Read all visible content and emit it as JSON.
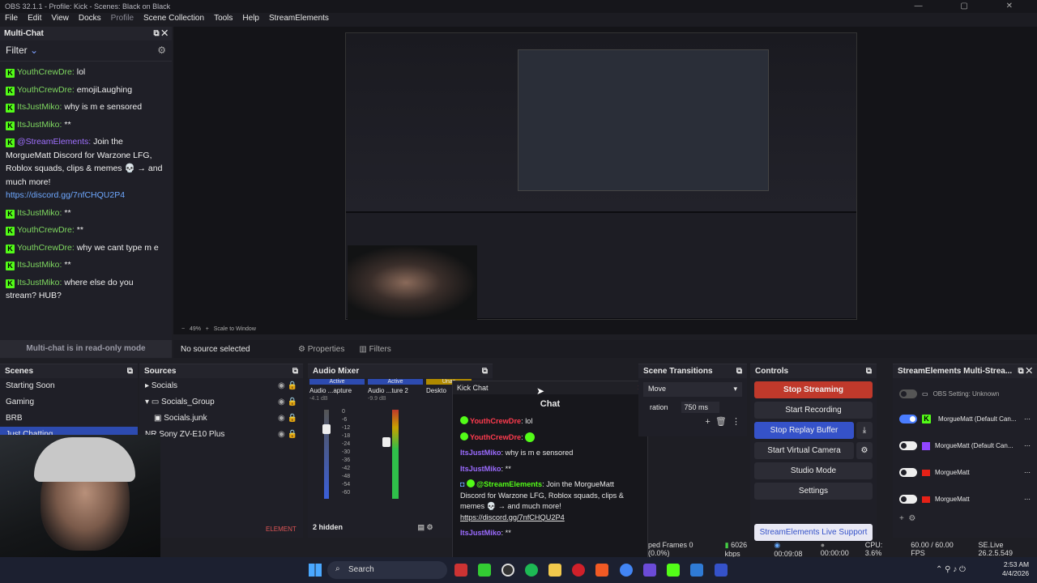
{
  "window": {
    "title": "OBS 32.1.1 - Profile: Kick - Scenes: Black on Black"
  },
  "menu": [
    "File",
    "Edit",
    "View",
    "Docks",
    "Profile",
    "Scene Collection",
    "Tools",
    "Help",
    "StreamElements"
  ],
  "multichat": {
    "title": "Multi-Chat",
    "filter_label": "Filter",
    "footer": "Multi-chat is in read-only mode",
    "messages": [
      {
        "user": "YouthCrewDre:",
        "text": " lol",
        "color": "green"
      },
      {
        "user": "YouthCrewDre:",
        "text": " emojiLaughing",
        "color": "green"
      },
      {
        "user": "ItsJustMiko:",
        "text": " why is m e sensored",
        "color": "green"
      },
      {
        "user": "ItsJustMiko:",
        "text": " **",
        "color": "green"
      },
      {
        "user": "@StreamElements:",
        "text": " Join the MorgueMatt Discord for Warzone LFG, Roblox squads, clips & memes 💀 → and much more!",
        "link": "https://discord.gg/7nfCHQU2P4",
        "color": "purple"
      },
      {
        "user": "ItsJustMiko:",
        "text": " **",
        "color": "green"
      },
      {
        "user": "YouthCrewDre:",
        "text": " **",
        "color": "green"
      },
      {
        "user": "YouthCrewDre:",
        "text": " why we cant type m e",
        "color": "green"
      },
      {
        "user": "ItsJustMiko:",
        "text": " **",
        "color": "green"
      },
      {
        "user": "ItsJustMiko:",
        "text": " where else do you stream? HUB?",
        "color": "green"
      }
    ]
  },
  "preview": {
    "zoom": "49%",
    "zoom_mode": "Scale to Window"
  },
  "propbar": {
    "no_source": "No source selected",
    "properties": "Properties",
    "filters": "Filters"
  },
  "scenes": {
    "title": "Scenes",
    "items": [
      "Starting Soon",
      "Gaming",
      "BRB",
      "Just Chatting"
    ]
  },
  "sources": {
    "title": "Sources",
    "items": [
      "Socials",
      "Socials_Group",
      "Socials.junk",
      "NR Sony ZV-E10 Plus"
    ]
  },
  "mixer": {
    "title": "Audio Mixer",
    "channels": [
      {
        "state": "Active",
        "name": "Audio ...apture",
        "db": "-4.1 dB"
      },
      {
        "state": "Active",
        "name": "Audio ...ture 2",
        "db": "-9.9 dB"
      },
      {
        "state": "Unac",
        "name": "Deskto",
        "db": "-4.1 dB"
      }
    ],
    "scale": [
      "0",
      "-6",
      "-12",
      "-18",
      "-24",
      "-30",
      "-36",
      "-42",
      "-48",
      "-54",
      "-60"
    ],
    "hidden": "2 hidden",
    "element_tag": "ELEMENT"
  },
  "kickchat": {
    "window_title": "Kick Chat",
    "title": "Chat",
    "lines": [
      {
        "user": "YouthCrewDre",
        "text": ": lol",
        "kind": "red"
      },
      {
        "user": "YouthCrewDre",
        "text": ":",
        "kind": "red"
      },
      {
        "user": "ItsJustMiko",
        "text": ": why is m e sensored",
        "kind": "purple"
      },
      {
        "user": "ItsJustMiko",
        "text": ": **",
        "kind": "purple"
      },
      {
        "user": "@StreamElements",
        "text": ": Join the MorgueMatt Discord for Warzone LFG, Roblox squads, clips & memes 💀 → and much more!",
        "link": "https://discord.gg/7nfCHQU2P4",
        "kind": "green"
      },
      {
        "user": "ItsJustMiko",
        "text": ": **",
        "kind": "purple"
      }
    ]
  },
  "transitions": {
    "title": "Scene Transitions",
    "type": "Move",
    "duration_label": "ration",
    "duration": "750 ms"
  },
  "controls": {
    "title": "Controls",
    "stop_streaming": "Stop Streaming",
    "start_recording": "Start Recording",
    "stop_replay": "Stop Replay Buffer",
    "virtual_cam": "Start Virtual Camera",
    "studio_mode": "Studio Mode",
    "settings": "Settings",
    "se_support": "StreamElements Live Support"
  },
  "se_multi": {
    "title": "StreamElements Multi-Strea...",
    "rows": [
      {
        "name": "OBS Setting: Unknown",
        "on": false,
        "platform": "dim"
      },
      {
        "name": "MorgueMatt (Default Can...",
        "on": true,
        "platform": "kick"
      },
      {
        "name": "MorgueMatt (Default Can...",
        "on": false,
        "platform": "twitch"
      },
      {
        "name": "MorgueMatt",
        "on": false,
        "platform": "youtube"
      },
      {
        "name": "MorgueMatt",
        "on": false,
        "platform": "youtube"
      }
    ]
  },
  "status": {
    "dropped": "ped Frames 0 (0.0%)",
    "bitrate": "6026 kbps",
    "live_time": "00:09:08",
    "rec_time": "00:00:00",
    "cpu": "CPU: 3.6%",
    "fps": "60.00 / 60.00 FPS",
    "version": "SE.Live 26.2.5.549"
  },
  "taskbar": {
    "search": "Search",
    "time": "2:53 AM",
    "date": "4/4/2026"
  },
  "colors": {
    "kick_green": "#53fc18",
    "accent_blue": "#3552c9",
    "stop_red": "#c0392b"
  }
}
